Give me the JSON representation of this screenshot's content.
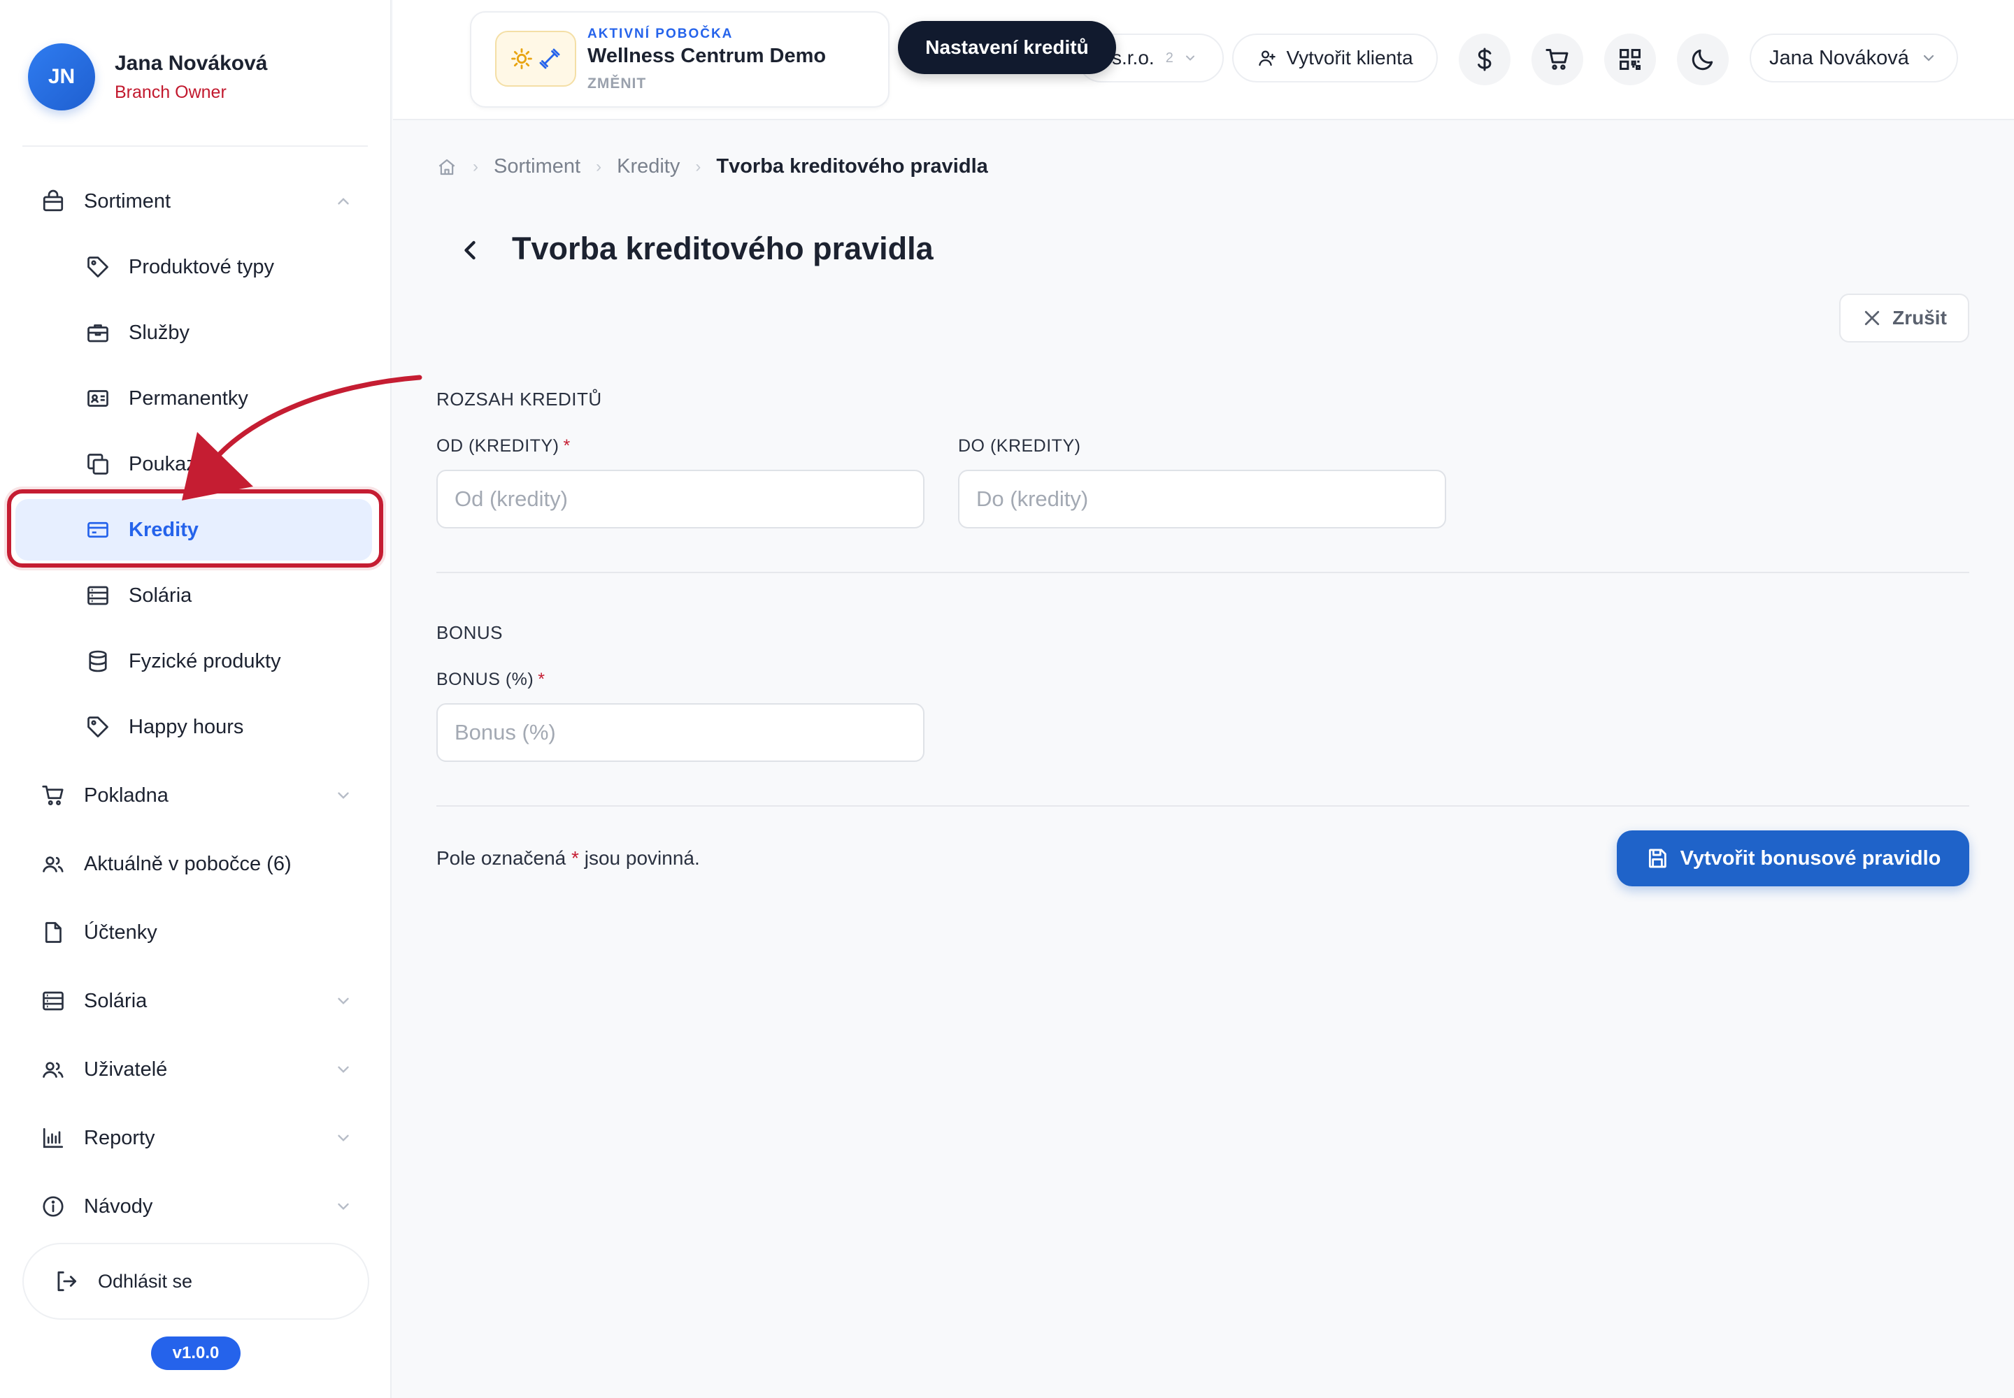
{
  "profile": {
    "initials": "JN",
    "name": "Jana Nováková",
    "role": "Branch Owner"
  },
  "sidebar": {
    "sortiment": {
      "label": "Sortiment",
      "icon": "shopping-bag-icon",
      "expanded": true
    },
    "sub_items": [
      {
        "label": "Produktové typy",
        "icon": "tag-icon"
      },
      {
        "label": "Služby",
        "icon": "briefcase-icon"
      },
      {
        "label": "Permanentky",
        "icon": "id-card-icon"
      },
      {
        "label": "Poukazy",
        "icon": "copy-icon"
      },
      {
        "label": "Kredity",
        "icon": "credit-card-icon",
        "active": true
      },
      {
        "label": "Solária",
        "icon": "server-icon"
      },
      {
        "label": "Fyzické produkty",
        "icon": "database-icon"
      },
      {
        "label": "Happy hours",
        "icon": "tag-icon"
      }
    ],
    "items": [
      {
        "label": "Pokladna",
        "icon": "cart-icon"
      },
      {
        "label": "Aktuálně v pobočce (6)",
        "icon": "users-icon"
      },
      {
        "label": "Účtenky",
        "icon": "file-icon"
      },
      {
        "label": "Solária",
        "icon": "server-icon"
      },
      {
        "label": "Uživatelé",
        "icon": "users-icon"
      },
      {
        "label": "Reporty",
        "icon": "bar-chart-icon"
      },
      {
        "label": "Návody",
        "icon": "info-icon"
      }
    ],
    "logout": "Odhlásit se",
    "version": "v1.0.0"
  },
  "topbar": {
    "branch_kicker": "AKTIVNÍ POBOČKA",
    "branch_name": "Wellness Centrum Demo",
    "branch_change": "ZMĚNIT",
    "tooltip": "Nastavení kreditů",
    "company_suffix": "s.r.o.",
    "company_count": "2",
    "create_client": "Vytvořit klienta",
    "user_name": "Jana Nováková"
  },
  "breadcrumb": {
    "items": [
      "Sortiment",
      "Kredity"
    ],
    "current": "Tvorba kreditového pravidla"
  },
  "page": {
    "title": "Tvorba kreditového pravidla",
    "cancel": "Zrušit",
    "range_section": "ROZSAH KREDITŮ",
    "from_label": "OD (KREDITY)",
    "from_placeholder": "Od (kredity)",
    "to_label": "DO (KREDITY)",
    "to_placeholder": "Do (kredity)",
    "bonus_section": "BONUS",
    "bonus_label": "BONUS (%)",
    "bonus_placeholder": "Bonus (%)",
    "required_mark": "*",
    "note_before": "Pole označená",
    "note_after": "jsou povinná.",
    "submit": "Vytvořit bonusové pravidlo"
  },
  "colors": {
    "accent": "#2563eb",
    "primary_button": "#1f63c9",
    "highlight": "#c51d32",
    "required": "#c51d32"
  }
}
